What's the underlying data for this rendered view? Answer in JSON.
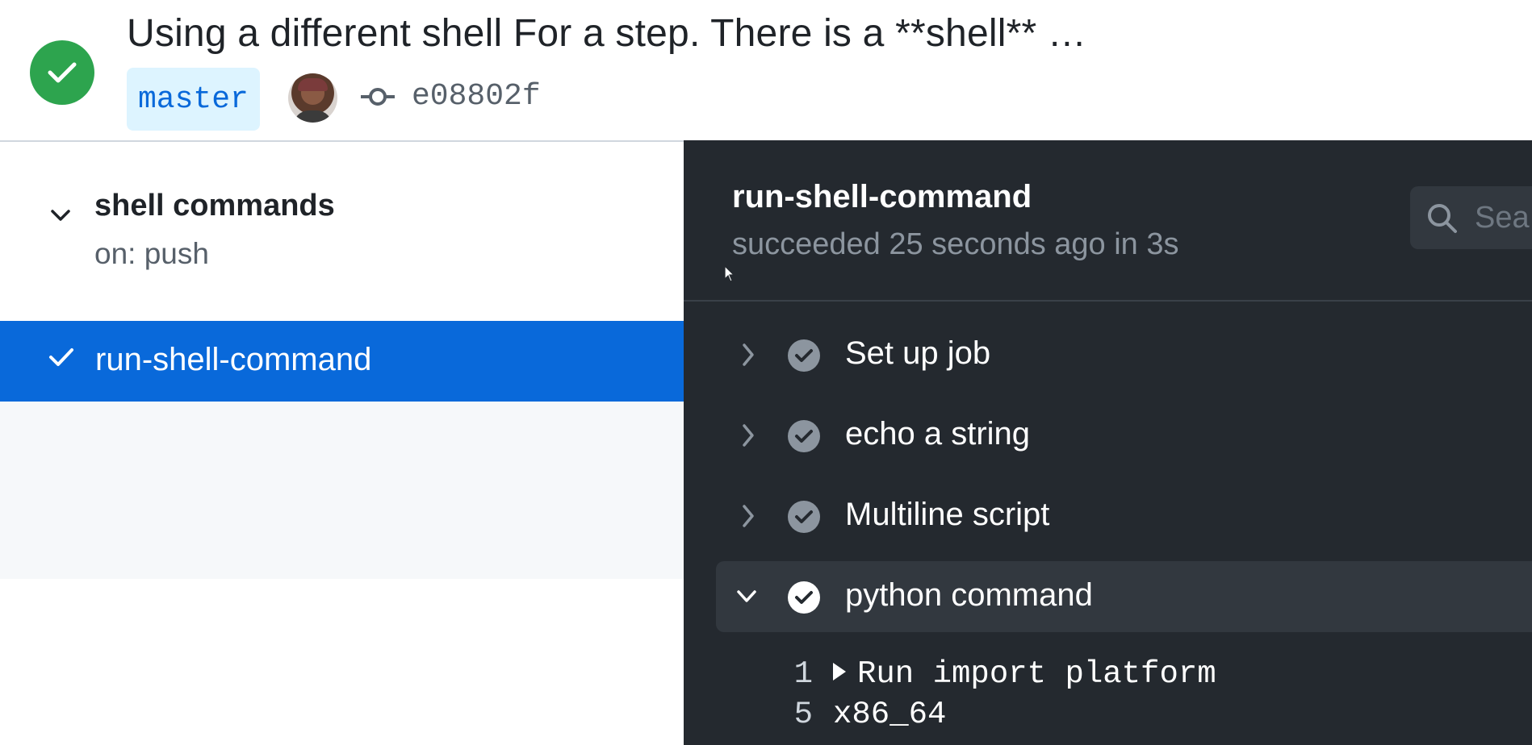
{
  "run": {
    "title": "Using a different shell For a step. There is a **shell** …",
    "branch": "master",
    "commit_sha": "e08802f",
    "status_color": "#2da44e"
  },
  "sidebar": {
    "workflow_name": "shell commands",
    "trigger": "on: push",
    "jobs": [
      {
        "label": "run-shell-command",
        "selected": true,
        "status": "success"
      }
    ],
    "selected_color": "#0969da"
  },
  "job": {
    "title": "run-shell-command",
    "status_text": "succeeded 25 seconds ago in 3s",
    "search_placeholder": "Sea",
    "steps": [
      {
        "label": "Set up job",
        "expanded": false,
        "status": "success"
      },
      {
        "label": "echo a string",
        "expanded": false,
        "status": "success"
      },
      {
        "label": "Multiline script",
        "expanded": false,
        "status": "success"
      },
      {
        "label": "python command",
        "expanded": true,
        "status": "success"
      }
    ],
    "log_lines": [
      {
        "num": "1",
        "text": "Run import platform",
        "collapsible": true
      },
      {
        "num": "5",
        "text": "x86_64",
        "collapsible": false
      }
    ]
  },
  "icons": {
    "status": "check-circle-icon",
    "commit": "git-commit-icon",
    "search": "search-icon",
    "chevron_right": "chevron-right-icon",
    "chevron_down": "chevron-down-icon",
    "cursor": "mouse-cursor-icon"
  }
}
